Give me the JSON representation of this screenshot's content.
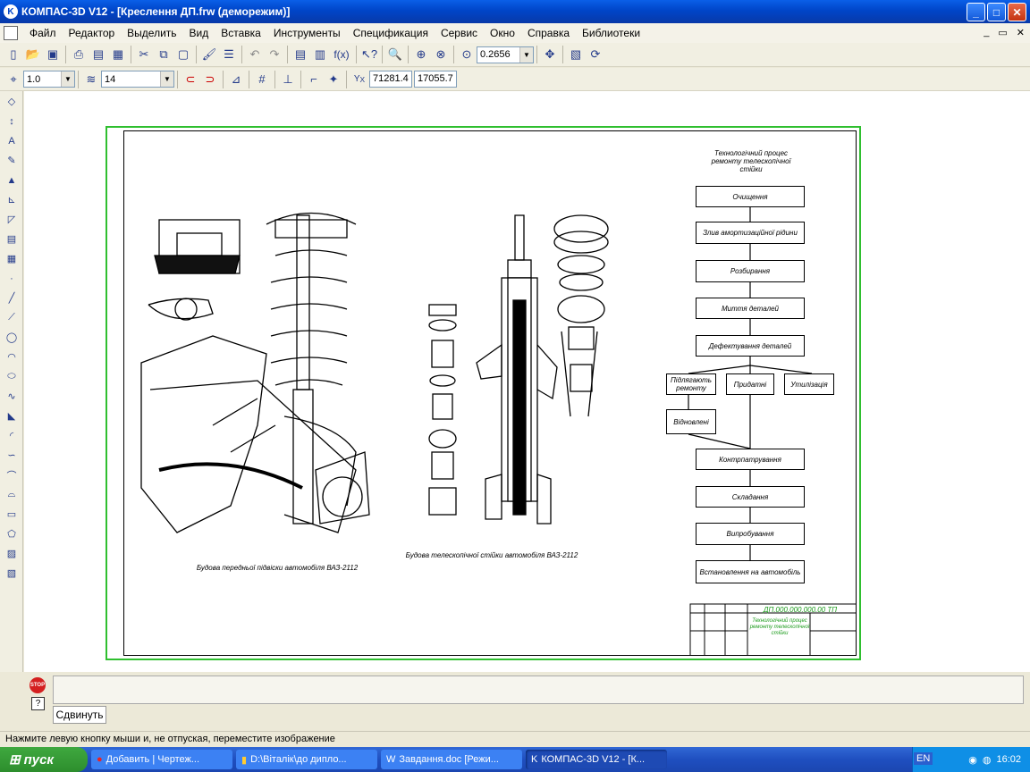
{
  "window": {
    "title": "КОМПАС-3D V12 - [Креслення ДП.frw (деморежим)]",
    "min_label": "_",
    "max_label": "□",
    "close_label": "✕"
  },
  "menu": [
    "Файл",
    "Редактор",
    "Выделить",
    "Вид",
    "Вставка",
    "Инструменты",
    "Спецификация",
    "Сервис",
    "Окно",
    "Справка",
    "Библиотеки"
  ],
  "toolbar": {
    "zoom_value": "0.2656",
    "fx_label": "f(x)"
  },
  "props": {
    "step_value": "1.0",
    "layer_value": "14",
    "coord_x": "71281.4",
    "coord_y": "17055.7"
  },
  "drawing": {
    "flow_title": "Технологічний процес ремонту телескопічної стійки",
    "flow_steps": [
      "Очищення",
      "Злив амортизаційної рідини",
      "Розбирання",
      "Миття деталей",
      "Дефектування деталей",
      "Придатні",
      "Утилізація",
      "Контрпатрування",
      "Складання",
      "Випробування",
      "Встановлення на автомобіль"
    ],
    "flow_side1": "Підлягають ремонту",
    "flow_side2": "Відновлені",
    "caption_left": "Будова передньої підвіски автомобіля ВАЗ-2112",
    "caption_mid": "Будова телескопічної стійки автомобіля ВАЗ-2112",
    "stamp_code": "ДП.000.000.000.00 ТП",
    "stamp_title": "Технологічний процес ремонту телескопічної стійки"
  },
  "command_panel": {
    "tab_label": "Сдвинуть",
    "stop_label": "STOP"
  },
  "status_text": "Нажмите левую кнопку мыши и, не отпуская, переместите изображение",
  "taskbar": {
    "start_label": "пуск",
    "tasks": [
      "Добавить | Чертеж...",
      "D:\\Віталік\\до дипло...",
      "Завдання.doc [Режи...",
      "КОМПАС-3D V12 - [К..."
    ],
    "lang": "EN",
    "clock": "16:02"
  },
  "colors": {
    "sheet_border": "#2fbf2f",
    "titlebar": "#0045c8"
  }
}
